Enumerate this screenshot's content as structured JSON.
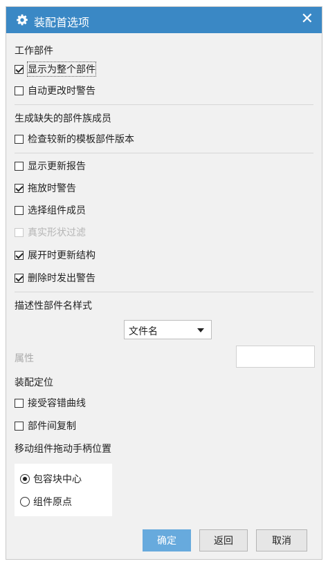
{
  "dialog": {
    "title": "装配首选项",
    "close_label": "✕"
  },
  "work_part": {
    "label": "工作部件",
    "options": [
      {
        "label": "显示为整个部件",
        "checked": true
      },
      {
        "label": "自动更改时警告",
        "checked": false
      }
    ]
  },
  "missing_family": {
    "label": "生成缺失的部件族成员",
    "options": [
      {
        "label": "检查较新的模板部件版本",
        "checked": false
      }
    ]
  },
  "general": {
    "options": [
      {
        "label": "显示更新报告",
        "checked": false
      },
      {
        "label": "拖放时警告",
        "checked": true
      },
      {
        "label": "选择组件成员",
        "checked": false
      },
      {
        "label": "真实形状过滤",
        "checked": false,
        "disabled": true
      },
      {
        "label": "展开时更新结构",
        "checked": true
      },
      {
        "label": "删除时发出警告",
        "checked": true
      }
    ]
  },
  "descriptive_name": {
    "label": "描述性部件名样式",
    "selected": "文件名",
    "attribute_label": "属性",
    "attribute_value": ""
  },
  "positioning": {
    "label": "装配定位",
    "options": [
      {
        "label": "接受容错曲线",
        "checked": false
      },
      {
        "label": "部件间复制",
        "checked": false
      }
    ]
  },
  "handle_position": {
    "label": "移动组件拖动手柄位置",
    "options": [
      {
        "label": "包容块中心",
        "selected": true
      },
      {
        "label": "组件原点",
        "selected": false
      }
    ]
  },
  "buttons": {
    "ok": "确定",
    "back": "返回",
    "cancel": "取消"
  },
  "colors": {
    "titlebar": "#3a88c5",
    "ok_button": "#67aadd",
    "dialog_bg": "#f1f1f1"
  }
}
